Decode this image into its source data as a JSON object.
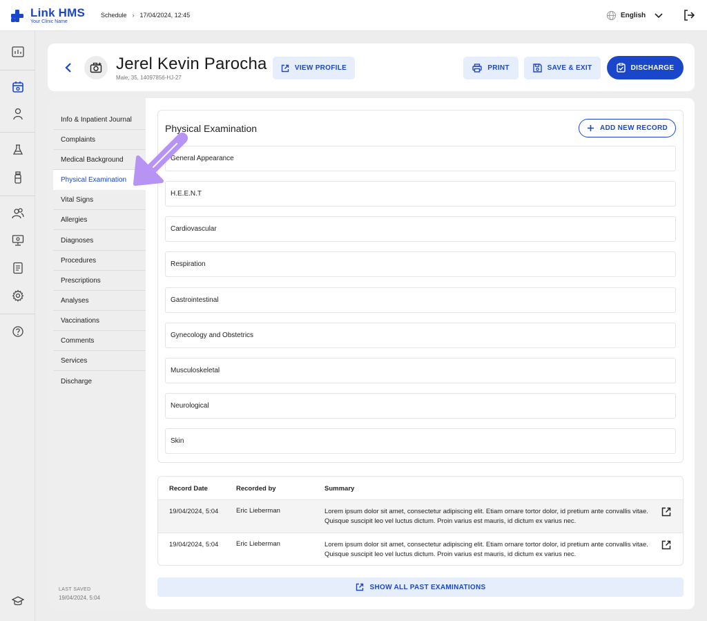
{
  "app": {
    "brand": "Link HMS",
    "tagline": "Your Clinic Name",
    "breadcrumb": {
      "section": "Schedule",
      "datetime": "17/04/2024, 12:45"
    },
    "language": "English"
  },
  "rail": {
    "items": [
      "dashboard-icon",
      "calendar-icon",
      "person-icon",
      "flask-icon",
      "bottle-icon",
      "users-icon",
      "monitor-icon",
      "report-icon",
      "gear-icon",
      "help-icon",
      "graduation-cap-icon"
    ],
    "active": "calendar-icon"
  },
  "patient": {
    "name": "Jerel Kevin Parocha",
    "meta": "Male, 35, 14097856-HJ-27"
  },
  "header_actions": {
    "view_profile": "VIEW PROFILE",
    "print": "PRINT",
    "save_exit": "SAVE & EXIT",
    "discharge": "DISCHARGE"
  },
  "sections": {
    "items": [
      "Info & Inpatient Journal",
      "Complaints",
      "Medical Background",
      "Physical Examination",
      "Vital Signs",
      "Allergies",
      "Diagnoses",
      "Procedures",
      "Prescriptions",
      "Analyses",
      "Vaccinations",
      "Comments",
      "Services",
      "Discharge"
    ],
    "active": "Physical Examination",
    "last_saved_label": "LAST SAVED",
    "last_saved_value": "19/04/2024, 5:04"
  },
  "exam": {
    "title": "Physical Examination",
    "add_button": "ADD NEW RECORD",
    "categories": [
      "General Appearance",
      "H.E.E.N.T",
      "Cardiovascular",
      "Respiration",
      "Gastrointestinal",
      "Gynecology and Obstetrics",
      "Musculoskeletal",
      "Neurological",
      "Skin"
    ]
  },
  "records": {
    "columns": [
      "Record Date",
      "Recorded by",
      "Summary"
    ],
    "rows": [
      {
        "date": "19/04/2024, 5:04",
        "by": "Eric Lieberman",
        "summary": "Lorem ipsum dolor sit amet, consectetur adipiscing elit. Etiam ornare tortor dolor, id pretium ante convallis vitae. Quisque suscipit leo vel luctus dictum. Proin varius est mauris, id dictum ex varius nec."
      },
      {
        "date": "19/04/2024, 5:04",
        "by": "Eric Lieberman",
        "summary": "Lorem ipsum dolor sit amet, consectetur adipiscing elit. Etiam ornare tortor dolor, id pretium ante convallis vitae. Quisque suscipit leo vel luctus dictum. Proin varius est mauris, id dictum ex varius nec."
      }
    ],
    "show_all": "SHOW ALL PAST EXAMINATIONS"
  },
  "colors": {
    "primary": "#1a47c9",
    "primary_light": "#e7eefb",
    "annotation": "#b794f4"
  }
}
